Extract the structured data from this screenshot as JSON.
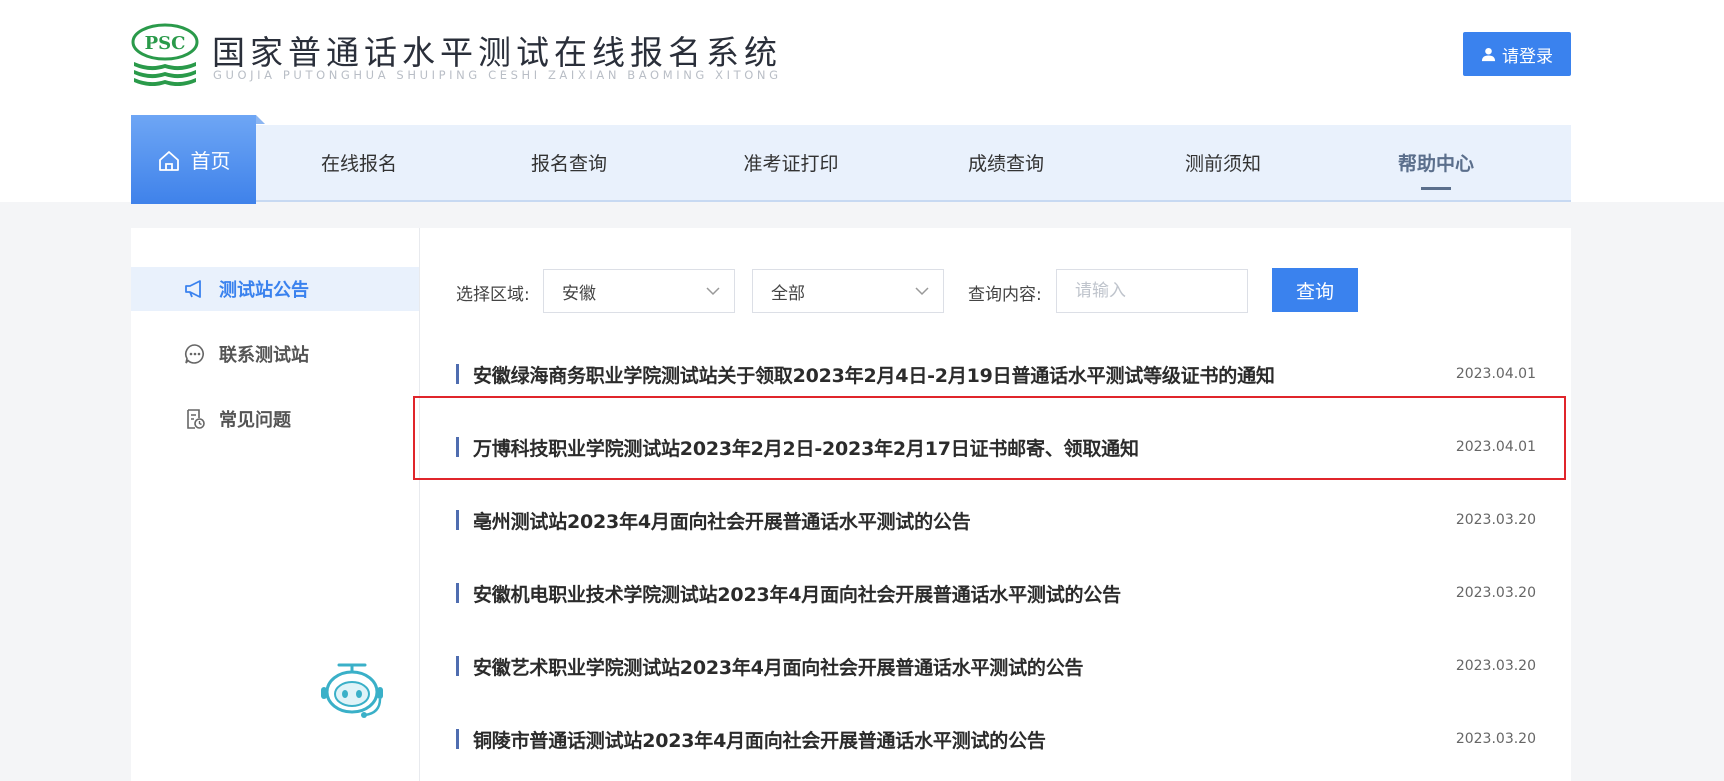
{
  "header": {
    "logo_text": "PSC",
    "title": "国家普通话水平测试在线报名系统",
    "subtitle": "GUOJIA PUTONGHUA SHUIPING CESHI ZAIXIAN BAOMING XITONG",
    "login_label": "请登录"
  },
  "nav": {
    "items": [
      {
        "label": "首页"
      },
      {
        "label": "在线报名"
      },
      {
        "label": "报名查询"
      },
      {
        "label": "准考证打印"
      },
      {
        "label": "成绩查询"
      },
      {
        "label": "测前须知"
      },
      {
        "label": "帮助中心"
      }
    ],
    "active_index": 6
  },
  "sidebar": {
    "items": [
      {
        "label": "测试站公告",
        "icon": "megaphone-icon"
      },
      {
        "label": "联系测试站",
        "icon": "chat-icon"
      },
      {
        "label": "常见问题",
        "icon": "document-clock-icon"
      }
    ],
    "active_index": 0
  },
  "filters": {
    "region_label": "选择区域:",
    "province_value": "安徽",
    "city_value": "全部",
    "query_label": "查询内容:",
    "query_placeholder": "请输入",
    "query_button": "查询"
  },
  "news": [
    {
      "title": "安徽绿海商务职业学院测试站关于领取2023年2月4日-2月19日普通话水平测试等级证书的通知",
      "date": "2023.04.01"
    },
    {
      "title": "万博科技职业学院测试站2023年2月2日-2023年2月17日证书邮寄、领取通知",
      "date": "2023.04.01"
    },
    {
      "title": "亳州测试站2023年4月面向社会开展普通话水平测试的公告",
      "date": "2023.03.20"
    },
    {
      "title": "安徽机电职业技术学院测试站2023年4月面向社会开展普通话水平测试的公告",
      "date": "2023.03.20"
    },
    {
      "title": "安徽艺术职业学院测试站2023年4月面向社会开展普通话水平测试的公告",
      "date": "2023.03.20"
    },
    {
      "title": "铜陵市普通话测试站2023年4月面向社会开展普通话水平测试的公告",
      "date": "2023.03.20"
    }
  ],
  "colors": {
    "primary": "#3a82ee",
    "highlight": "#e0252b",
    "logo_green": "#2a9a4a"
  }
}
